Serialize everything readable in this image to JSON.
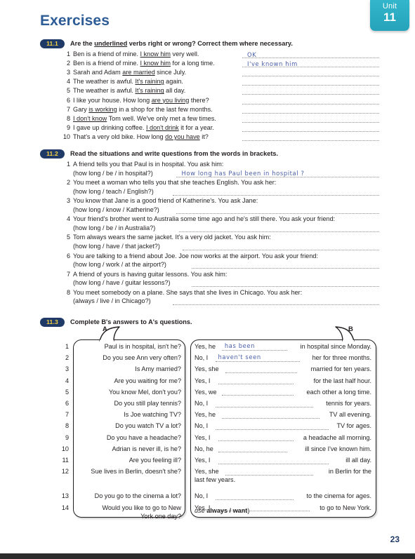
{
  "page": {
    "title": "Exercises",
    "page_number": "23",
    "unit_tab": {
      "word": "Unit",
      "number": "11",
      "color": "#2ba9bf"
    },
    "heading_color": "#2d5c96",
    "badge_bg": "#1f3a66",
    "badge_fg": "#f5d33f",
    "handwriting_color": "#4a5fa8"
  },
  "exercise_111": {
    "badge": "11.1",
    "instruction_parts": {
      "a": "Are the ",
      "u": "underlined",
      "b": " verbs right or wrong? Correct them where necessary."
    },
    "items": [
      {
        "n": "1",
        "pre": "Ben is a friend of mine.  ",
        "u": "I know him",
        "post": " very well.",
        "answer": "OK"
      },
      {
        "n": "2",
        "pre": "Ben is a friend of mine.  ",
        "u": "I know him",
        "post": " for a long time.",
        "answer": "I've known him"
      },
      {
        "n": "3",
        "pre": "Sarah and Adam ",
        "u": "are married",
        "post": " since July.",
        "answer": ""
      },
      {
        "n": "4",
        "pre": "The weather is awful.  ",
        "u": "It's raining",
        "post": " again.",
        "answer": ""
      },
      {
        "n": "5",
        "pre": "The weather is awful.  ",
        "u": "It's raining",
        "post": " all day.",
        "answer": ""
      },
      {
        "n": "6",
        "pre": "I like your house.  How long ",
        "u": "are you living",
        "post": " there?",
        "answer": ""
      },
      {
        "n": "7",
        "pre": "Gary ",
        "u": "is working",
        "post": " in a shop for the last few months.",
        "answer": ""
      },
      {
        "n": "8",
        "pre": "",
        "u": "I don't know",
        "post": " Tom well.  We've only met a few times.",
        "answer": ""
      },
      {
        "n": "9",
        "pre": "I gave up drinking coffee.  ",
        "u": "I don't drink",
        "post": " it for a year.",
        "answer": ""
      },
      {
        "n": "10",
        "pre": "That's a very old bike.  How long ",
        "u": "do you have",
        "post": " it?",
        "answer": ""
      }
    ]
  },
  "exercise_112": {
    "badge": "11.2",
    "instruction": "Read the situations and write questions from the words in brackets.",
    "items": [
      {
        "n": "1",
        "situation": "A friend tells you that Paul is in hospital.  You ask him:",
        "prompt": "(how long / be / in hospital?)",
        "answer": "How long has Paul been in hospital ?"
      },
      {
        "n": "2",
        "situation": "You meet a woman who tells you that she teaches English.  You ask her:",
        "prompt": "(how long / teach / English?)",
        "answer": ""
      },
      {
        "n": "3",
        "situation": "You know that Jane is a good friend of Katherine's.  You ask Jane:",
        "prompt": "(how long / know / Katherine?)",
        "answer": ""
      },
      {
        "n": "4",
        "situation": "Your friend's brother went to Australia some time ago and he's still there.  You ask your friend:",
        "prompt": "(how long / be / in Australia?)",
        "answer": ""
      },
      {
        "n": "5",
        "situation": "Tom always wears the same jacket.  It's a very old jacket.  You ask him:",
        "prompt": "(how long / have / that jacket?)",
        "answer": ""
      },
      {
        "n": "6",
        "situation": "You are talking to a friend about Joe.  Joe now works at the airport.  You ask your friend:",
        "prompt": "(how long / work / at the airport?)",
        "answer": ""
      },
      {
        "n": "7",
        "situation": "A friend of yours is having guitar lessons.  You ask him:",
        "prompt": "(how long / have / guitar lessons?)",
        "answer": ""
      },
      {
        "n": "8",
        "situation": "You meet somebody on a plane.  She says that she lives in Chicago.  You ask her:",
        "prompt": "(always / live / in Chicago?)",
        "answer": ""
      }
    ]
  },
  "exercise_113": {
    "badge": "11.3",
    "instruction": "Complete B's answers to A's questions.",
    "label_a": "A",
    "label_b": "B",
    "note": "(use always / want)",
    "note_italic": "use",
    "note_bold": "always / want",
    "rows": [
      {
        "n": "1",
        "question": "Paul is in hospital, isn't he?",
        "lead": "Yes, he",
        "answer": "has been",
        "tail": "in hospital since Monday."
      },
      {
        "n": "2",
        "question": "Do you see Ann very often?",
        "lead": "No, I",
        "answer": "haven't seen",
        "tail": "her for three months."
      },
      {
        "n": "3",
        "question": "Is Amy married?",
        "lead": "Yes, she",
        "answer": "",
        "tail": "married for ten years."
      },
      {
        "n": "4",
        "question": "Are you waiting for me?",
        "lead": "Yes, I",
        "answer": "",
        "tail": "for the last half hour."
      },
      {
        "n": "5",
        "question": "You know Mel, don't you?",
        "lead": "Yes, we",
        "answer": "",
        "tail": "each other a long time."
      },
      {
        "n": "6",
        "question": "Do you still play tennis?",
        "lead": "No, I",
        "answer": "",
        "tail": "tennis for years."
      },
      {
        "n": "7",
        "question": "Is Joe watching TV?",
        "lead": "Yes, he",
        "answer": "",
        "tail": "TV all evening."
      },
      {
        "n": "8",
        "question": "Do you watch TV a lot?",
        "lead": "No, I",
        "answer": "",
        "tail": "TV for ages."
      },
      {
        "n": "9",
        "question": "Do you have a headache?",
        "lead": "Yes, I",
        "answer": "",
        "tail": "a headache all morning."
      },
      {
        "n": "10",
        "question": "Adrian is never ill, is he?",
        "lead": "No, he",
        "answer": "",
        "tail": "ill since I've known him."
      },
      {
        "n": "11",
        "question": "Are you feeling ill?",
        "lead": "Yes, I",
        "answer": "",
        "tail": "ill all day."
      },
      {
        "n": "12",
        "question": "Sue lives in Berlin, doesn't she?",
        "lead": "Yes, she",
        "answer": "",
        "tail": "in Berlin for the"
      },
      {
        "n": "13",
        "question": "Do you go to the cinema a lot?",
        "lead": "No, I",
        "answer": "",
        "tail": "to the cinema for ages."
      },
      {
        "n": "14",
        "question": "Would you like to go to New",
        "lead": "Yes, I",
        "answer": "",
        "tail": "to go to New York."
      }
    ],
    "row12_wrap": "last few years.",
    "row14_wrap": "York one day?"
  }
}
